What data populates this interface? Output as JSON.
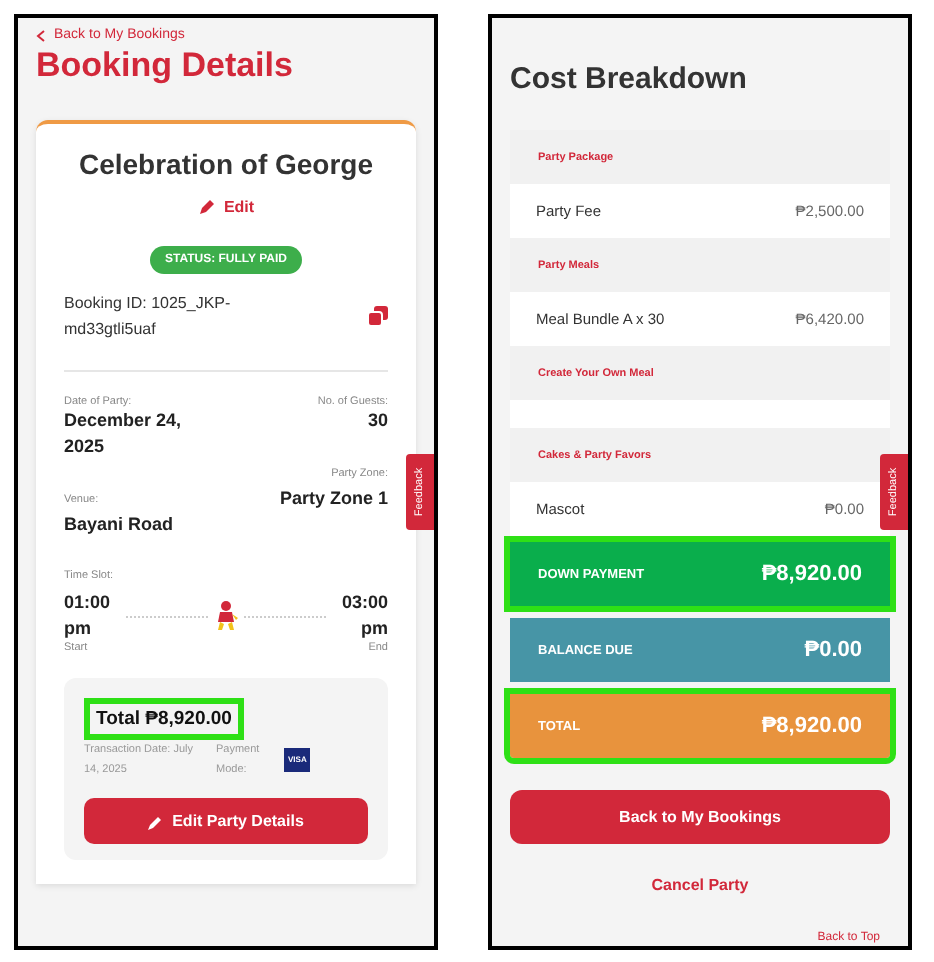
{
  "booking_details": {
    "back_link": "Back to My Bookings",
    "title": "Booking Details",
    "feedback_tab": "Feedback",
    "card": {
      "party_name": "Celebration of George",
      "edit_link": "Edit",
      "status": "STATUS: FULLY PAID",
      "booking_id": "Booking ID: 1025_JKP-md33gtli5uaf",
      "date_label": "Date of Party:",
      "date": "December 24, 2025",
      "guests_label": "No. of Guests:",
      "guests": "30",
      "zone_label": "Party Zone:",
      "venue_label": "Venue:",
      "zone": "Party Zone 1",
      "venue": "Bayani Road",
      "time_label": "Time Slot:",
      "start_time": "01:00 pm",
      "end_time": "03:00 pm",
      "start_label": "Start",
      "end_label": "End",
      "payment": {
        "total": "Total ₱8,920.00",
        "highlighted": true,
        "transaction_date": "Transaction Date: July 14, 2025",
        "payment_mode_label": "Payment Mode:",
        "payment_mode": "VISA"
      },
      "edit_button": "Edit Party Details"
    }
  },
  "cost_breakdown": {
    "title": "Cost Breakdown",
    "feedback_tab": "Feedback",
    "sections": [
      {
        "heading": "Party Package",
        "items": [
          {
            "name": "Party Fee",
            "price": "₱2,500.00"
          }
        ]
      },
      {
        "heading": "Party Meals",
        "items": [
          {
            "name": "Meal Bundle A x 30",
            "price": "₱6,420.00"
          }
        ]
      },
      {
        "heading": "Create Your Own Meal"
      },
      {
        "heading": "Cakes & Party Favors",
        "items": [
          {
            "name": "Mascot",
            "price": "₱0.00"
          }
        ]
      }
    ],
    "summary": [
      {
        "label": "DOWN PAYMENT",
        "amount": "₱8,920.00",
        "color": "#0aae4c",
        "highlighted": true
      },
      {
        "label": "BALANCE DUE",
        "amount": "₱0.00",
        "color": "#4795a6",
        "highlighted": false
      },
      {
        "label": "TOTAL",
        "amount": "₱8,920.00",
        "color": "#e8933d",
        "highlighted": true
      }
    ],
    "back_button": "Back to My Bookings",
    "cancel_link": "Cancel Party",
    "back_to_top": "Back to Top"
  }
}
